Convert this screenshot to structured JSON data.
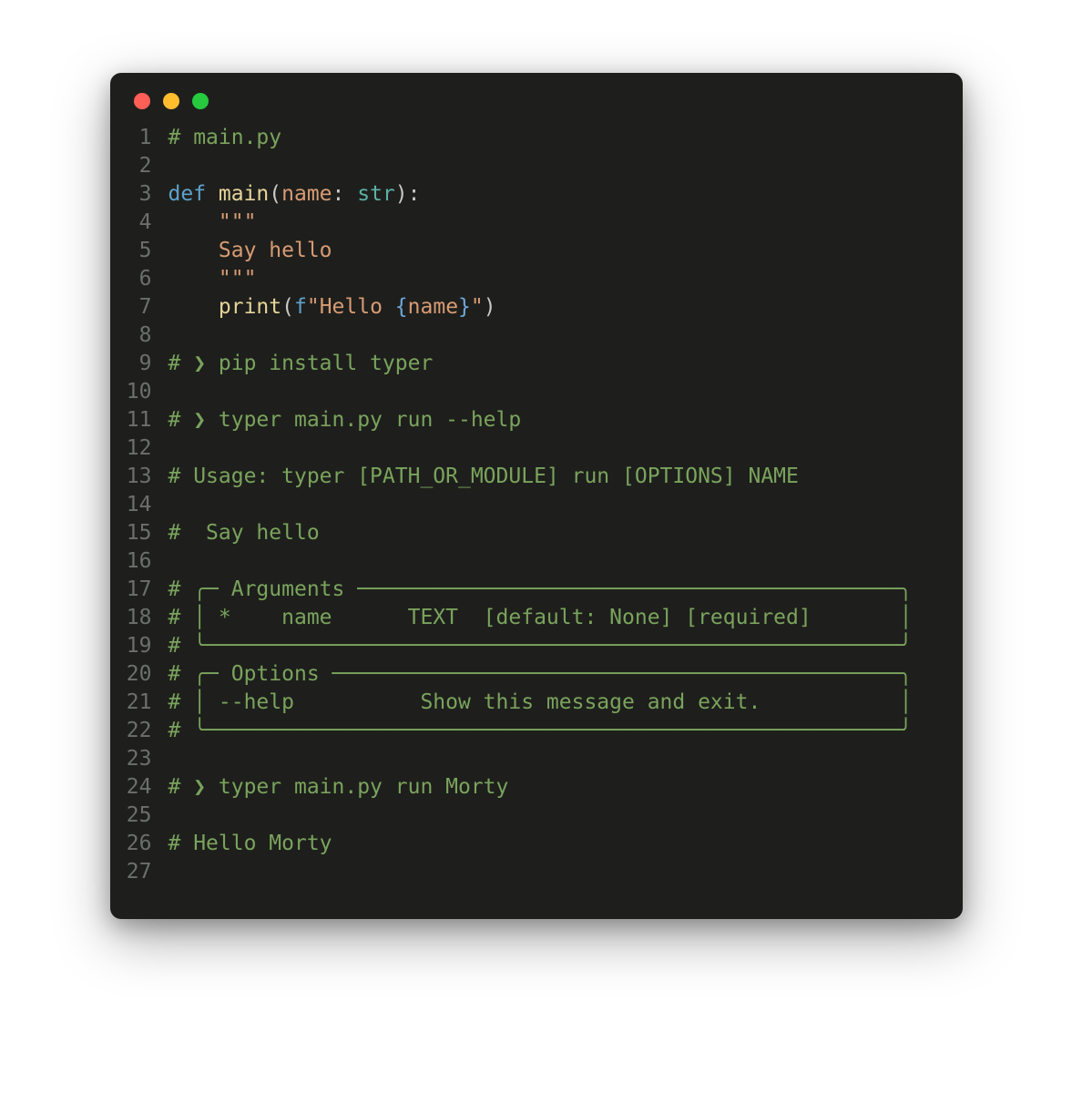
{
  "window": {
    "dots": [
      "red",
      "yellow",
      "green"
    ]
  },
  "code": {
    "lines": [
      {
        "n": 1,
        "tokens": [
          {
            "cls": "c-comment",
            "t": "# main.py"
          }
        ]
      },
      {
        "n": 2,
        "tokens": [
          {
            "cls": "",
            "t": ""
          }
        ]
      },
      {
        "n": 3,
        "tokens": [
          {
            "cls": "c-key",
            "t": "def "
          },
          {
            "cls": "c-fn",
            "t": "main"
          },
          {
            "cls": "c-punct",
            "t": "("
          },
          {
            "cls": "c-param",
            "t": "name"
          },
          {
            "cls": "c-punct",
            "t": ": "
          },
          {
            "cls": "c-type",
            "t": "str"
          },
          {
            "cls": "c-punct",
            "t": "):"
          }
        ]
      },
      {
        "n": 4,
        "tokens": [
          {
            "cls": "c-str",
            "t": "    \"\"\""
          }
        ]
      },
      {
        "n": 5,
        "tokens": [
          {
            "cls": "c-str",
            "t": "    Say hello"
          }
        ]
      },
      {
        "n": 6,
        "tokens": [
          {
            "cls": "c-str",
            "t": "    \"\"\""
          }
        ]
      },
      {
        "n": 7,
        "tokens": [
          {
            "cls": "",
            "t": "    "
          },
          {
            "cls": "c-fn",
            "t": "print"
          },
          {
            "cls": "c-punct",
            "t": "("
          },
          {
            "cls": "c-key",
            "t": "f"
          },
          {
            "cls": "c-str",
            "t": "\"Hello "
          },
          {
            "cls": "c-brace",
            "t": "{"
          },
          {
            "cls": "c-param",
            "t": "name"
          },
          {
            "cls": "c-brace",
            "t": "}"
          },
          {
            "cls": "c-str",
            "t": "\""
          },
          {
            "cls": "c-punct",
            "t": ")"
          }
        ]
      },
      {
        "n": 8,
        "tokens": [
          {
            "cls": "",
            "t": ""
          }
        ]
      },
      {
        "n": 9,
        "tokens": [
          {
            "cls": "c-comment",
            "t": "# ❯ pip install typer"
          }
        ]
      },
      {
        "n": 10,
        "tokens": [
          {
            "cls": "",
            "t": ""
          }
        ]
      },
      {
        "n": 11,
        "tokens": [
          {
            "cls": "c-comment",
            "t": "# ❯ typer main.py run --help"
          }
        ]
      },
      {
        "n": 12,
        "tokens": [
          {
            "cls": "",
            "t": ""
          }
        ]
      },
      {
        "n": 13,
        "tokens": [
          {
            "cls": "c-comment",
            "t": "# Usage: typer [PATH_OR_MODULE] run [OPTIONS] NAME"
          }
        ]
      },
      {
        "n": 14,
        "tokens": [
          {
            "cls": "",
            "t": ""
          }
        ]
      },
      {
        "n": 15,
        "tokens": [
          {
            "cls": "c-comment",
            "t": "#  Say hello"
          }
        ]
      },
      {
        "n": 16,
        "tokens": [
          {
            "cls": "",
            "t": ""
          }
        ]
      },
      {
        "n": 17,
        "tokens": [
          {
            "cls": "c-comment",
            "t": "# ╭─ Arguments ───────────────────────────────────────────╮"
          }
        ]
      },
      {
        "n": 18,
        "tokens": [
          {
            "cls": "c-comment",
            "t": "# │ *    name      TEXT  [default: None] [required]       │"
          }
        ]
      },
      {
        "n": 19,
        "tokens": [
          {
            "cls": "c-comment",
            "t": "# ╰───────────────────────────────────────────────────────╯"
          }
        ]
      },
      {
        "n": 20,
        "tokens": [
          {
            "cls": "c-comment",
            "t": "# ╭─ Options ─────────────────────────────────────────────╮"
          }
        ]
      },
      {
        "n": 21,
        "tokens": [
          {
            "cls": "c-comment",
            "t": "# │ --help          Show this message and exit.           │"
          }
        ]
      },
      {
        "n": 22,
        "tokens": [
          {
            "cls": "c-comment",
            "t": "# ╰───────────────────────────────────────────────────────╯"
          }
        ]
      },
      {
        "n": 23,
        "tokens": [
          {
            "cls": "",
            "t": ""
          }
        ]
      },
      {
        "n": 24,
        "tokens": [
          {
            "cls": "c-comment",
            "t": "# ❯ typer main.py run Morty"
          }
        ]
      },
      {
        "n": 25,
        "tokens": [
          {
            "cls": "",
            "t": ""
          }
        ]
      },
      {
        "n": 26,
        "tokens": [
          {
            "cls": "c-comment",
            "t": "# Hello Morty"
          }
        ]
      },
      {
        "n": 27,
        "tokens": [
          {
            "cls": "",
            "t": ""
          }
        ]
      }
    ]
  }
}
